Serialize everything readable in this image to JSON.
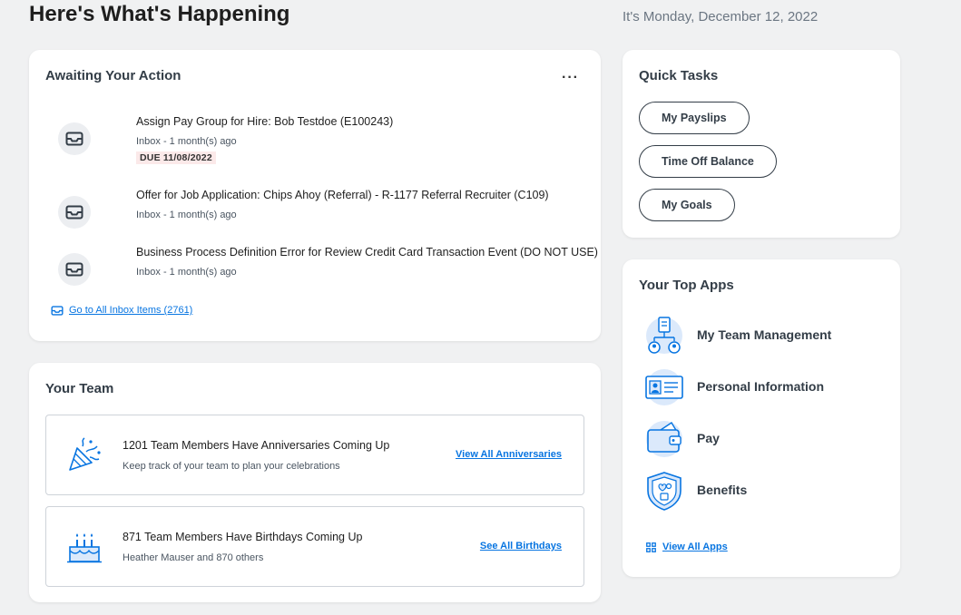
{
  "header": {
    "title": "Here's What's Happening",
    "date": "It's Monday, December 12, 2022"
  },
  "awaiting": {
    "title": "Awaiting Your Action",
    "more": "···",
    "items": [
      {
        "title": "Assign Pay Group for Hire: Bob Testdoe (E100243)",
        "meta": "Inbox - 1 month(s) ago",
        "due": "DUE 11/08/2022"
      },
      {
        "title": "Offer for Job Application: Chips Ahoy (Referral) - R-1177 Referral Recruiter (C109)",
        "meta": "Inbox - 1 month(s) ago"
      },
      {
        "title": "Business Process Definition Error for Review Credit Card Transaction Event (DO NOT USE)",
        "meta": "Inbox - 1 month(s) ago"
      }
    ],
    "link": "Go to All Inbox Items (2761)"
  },
  "team": {
    "title": "Your Team",
    "anniversaries": {
      "title": "1201 Team Members Have Anniversaries Coming Up",
      "sub": "Keep track of your team to plan your celebrations",
      "link": "View All Anniversaries"
    },
    "birthdays": {
      "title": "871 Team Members Have Birthdays Coming Up",
      "sub": "Heather Mauser and 870 others",
      "link": "See All Birthdays"
    }
  },
  "quick": {
    "title": "Quick Tasks",
    "tasks": [
      "My Payslips",
      "Time Off Balance",
      "My Goals"
    ]
  },
  "apps": {
    "title": "Your Top Apps",
    "items": [
      {
        "label": "My Team Management",
        "icon": "team-management-icon"
      },
      {
        "label": "Personal Information",
        "icon": "id-card-icon"
      },
      {
        "label": "Pay",
        "icon": "wallet-icon"
      },
      {
        "label": "Benefits",
        "icon": "shield-icon"
      }
    ],
    "link": "View All Apps"
  },
  "colors": {
    "link": "#0875e1",
    "background": "#f0f1f2",
    "due_bg": "#fbe9e9"
  }
}
